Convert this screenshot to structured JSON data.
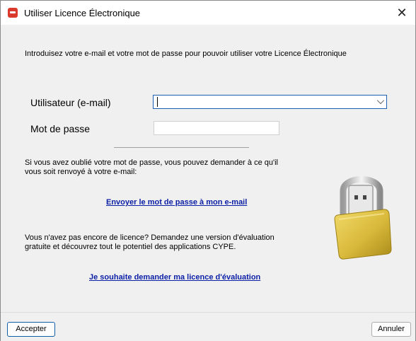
{
  "window": {
    "title": "Utiliser Licence Électronique"
  },
  "intro_text": "Introduisez votre e-mail et votre mot de passe pour pouvoir utiliser votre Licence Électronique",
  "form": {
    "user_label": "Utilisateur (e-mail)",
    "user_value": "",
    "password_label": "Mot de passe",
    "password_value": ""
  },
  "forgot": {
    "line1": "Si vous avez oublié votre mot de passe, vous pouvez demander à ce qu'il",
    "line2": "vous soit renvoyé à votre e-mail:",
    "link": "Envoyer le mot de passe à mon e-mail"
  },
  "trial": {
    "line1": "Vous n'avez pas encore de licence? Demandez une version d'évaluation",
    "line2": "gratuite et découvrez tout le potentiel des applications CYPE.",
    "link": "Je souhaite demander ma licence d'évaluation"
  },
  "buttons": {
    "accept": "Accepter",
    "cancel": "Annuler"
  },
  "colors": {
    "link": "#0b1fa6",
    "focus_border": "#1a5fb4",
    "lock_body": "#d9b93a"
  }
}
